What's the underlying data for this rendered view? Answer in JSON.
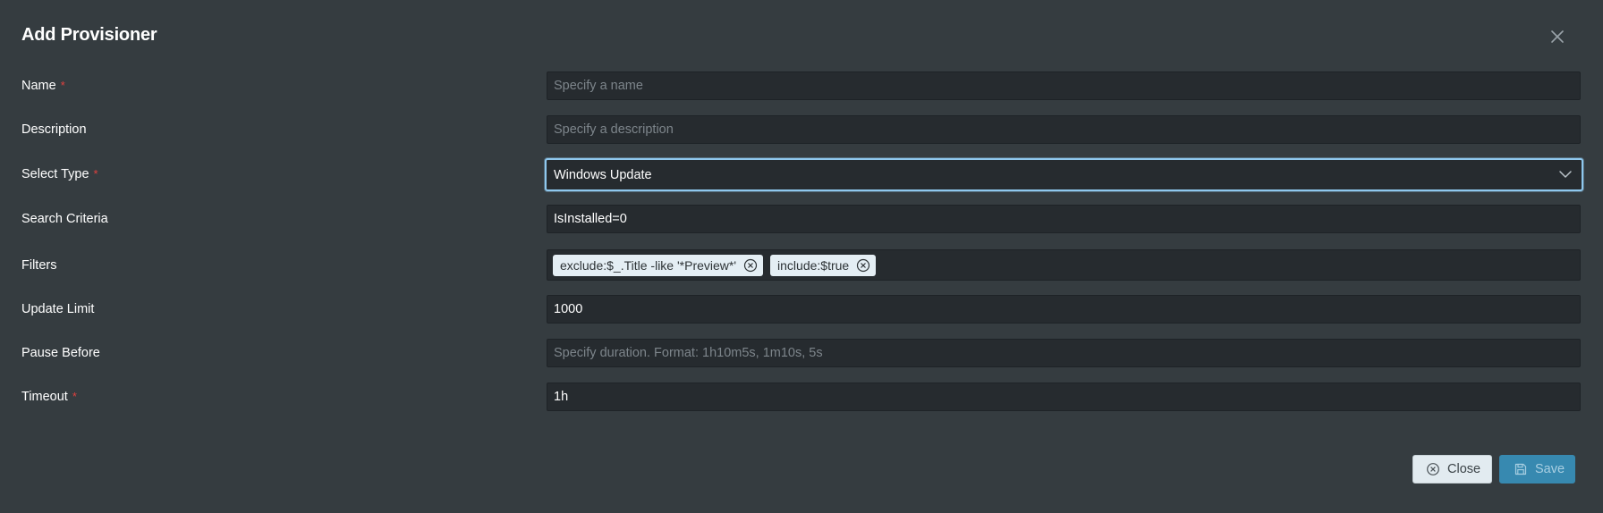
{
  "dialog": {
    "title": "Add Provisioner",
    "close_icon": "close-icon"
  },
  "form": {
    "name": {
      "label": "Name",
      "required_mark": "*",
      "value": "",
      "placeholder": "Specify a name"
    },
    "description": {
      "label": "Description",
      "value": "",
      "placeholder": "Specify a description"
    },
    "select_type": {
      "label": "Select Type",
      "required_mark": "*",
      "selected": "Windows Update",
      "icon": "chevron-down-icon"
    },
    "search_criteria": {
      "label": "Search Criteria",
      "value": "IsInstalled=0",
      "placeholder": ""
    },
    "filters": {
      "label": "Filters",
      "chips": [
        {
          "text": "exclude:$_.Title -like '*Preview*'",
          "icon": "remove-circle-icon"
        },
        {
          "text": "include:$true",
          "icon": "remove-circle-icon"
        }
      ]
    },
    "update_limit": {
      "label": "Update Limit",
      "value": "1000",
      "placeholder": ""
    },
    "pause_before": {
      "label": "Pause Before",
      "value": "",
      "placeholder": "Specify duration. Format: 1h10m5s, 1m10s, 5s"
    },
    "timeout": {
      "label": "Timeout",
      "required_mark": "*",
      "value": "1h",
      "placeholder": ""
    }
  },
  "footer": {
    "close_label": "Close",
    "close_icon": "close-circle-icon",
    "save_label": "Save",
    "save_icon": "save-icon"
  },
  "colors": {
    "background": "#353c40",
    "field_background": "#262b2f",
    "focus_border": "#8fc8ee",
    "required": "#e0413f",
    "chip_background": "#e4eef4",
    "save_button": "#3789b0",
    "close_button": "#e2ebf0"
  }
}
